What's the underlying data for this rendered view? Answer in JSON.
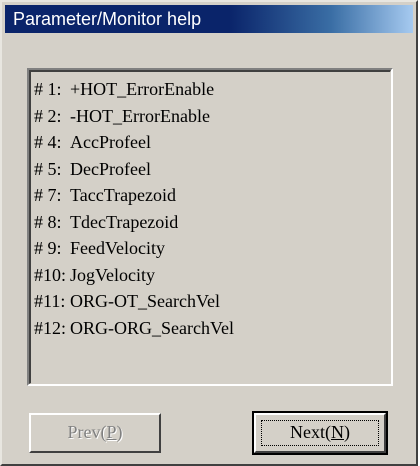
{
  "window": {
    "title": "Parameter/Monitor help"
  },
  "parameter_list": {
    "items": [
      {
        "num": "# 1:",
        "name": "+HOT_ErrorEnable"
      },
      {
        "num": "# 2:",
        "name": "-HOT_ErrorEnable"
      },
      {
        "num": "# 4:",
        "name": "AccProfeel"
      },
      {
        "num": "# 5:",
        "name": "DecProfeel"
      },
      {
        "num": "# 7:",
        "name": "TaccTrapezoid"
      },
      {
        "num": "# 8:",
        "name": "TdecTrapezoid"
      },
      {
        "num": "# 9:",
        "name": "FeedVelocity"
      },
      {
        "num": "#10:",
        "name": "JogVelocity"
      },
      {
        "num": "#11:",
        "name": "ORG-OT_SearchVel"
      },
      {
        "num": "#12:",
        "name": "ORG-ORG_SearchVel"
      }
    ]
  },
  "buttons": {
    "prev_label": "Prev(",
    "prev_hotkey": "P",
    "prev_suffix": ")",
    "prev_enabled": false,
    "next_label": "Next(",
    "next_hotkey": "N",
    "next_suffix": ")",
    "next_enabled": true
  }
}
